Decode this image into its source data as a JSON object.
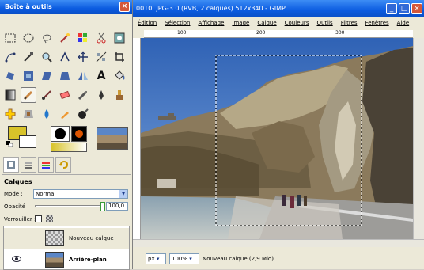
{
  "toolbox": {
    "title": "Boîte à outils",
    "layers": {
      "title": "Calques",
      "mode_label": "Mode :",
      "mode_value": "Normal",
      "opacity_label": "Opacité :",
      "opacity_value": "100,0",
      "lock_label": "Verrouiller :",
      "items": [
        {
          "name": "Nouveau calque",
          "visible": false
        },
        {
          "name": "Arrière-plan",
          "visible": true
        }
      ]
    },
    "colors": {
      "foreground": "#d8c32a",
      "background": "#ffffff"
    }
  },
  "image_window": {
    "title": "0010..JPG-3.0 (RVB, 2 calques) 512x340 - GIMP",
    "menu": [
      "Édition",
      "Sélection",
      "Affichage",
      "Image",
      "Calque",
      "Couleurs",
      "Outils",
      "Filtres",
      "Fenêtres",
      "Aide"
    ],
    "ruler_ticks": [
      "100",
      "200",
      "300"
    ],
    "unit": "px",
    "zoom": "100%",
    "status": "Nouveau calque (2,9 Mio)"
  }
}
